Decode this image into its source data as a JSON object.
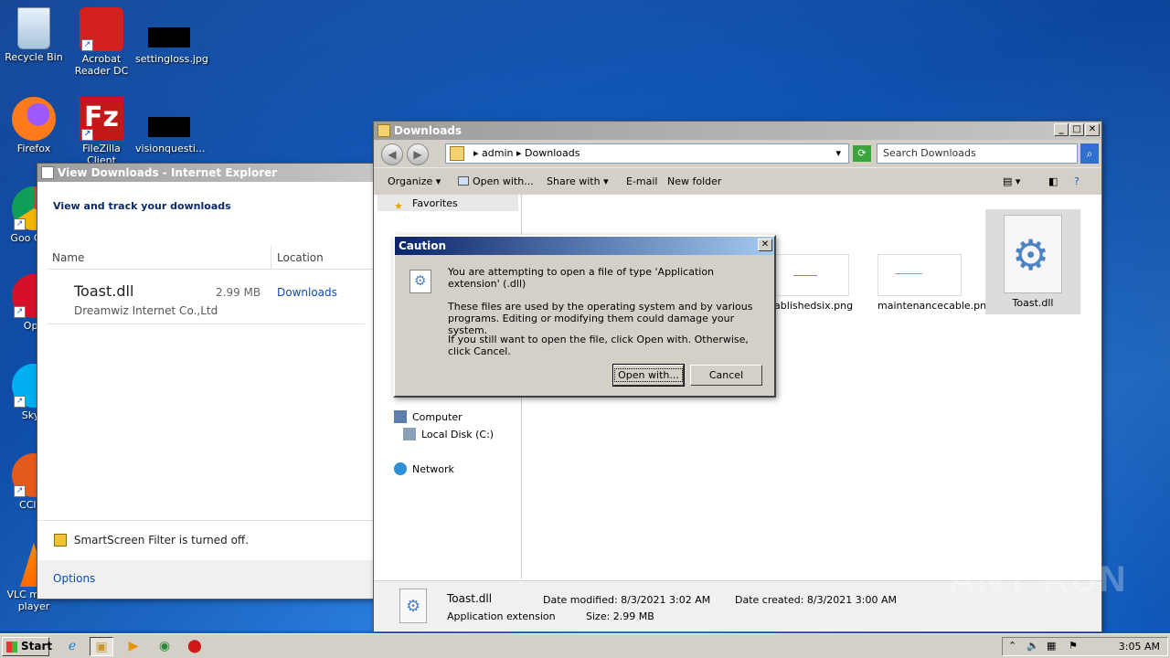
{
  "desktop": {
    "icons": [
      {
        "label": "Recycle Bin"
      },
      {
        "label": "Acrobat Reader DC"
      },
      {
        "label": "settingloss.jpg"
      },
      {
        "label": "Firefox"
      },
      {
        "label": "FileZilla Client"
      },
      {
        "label": "visionquesti..."
      },
      {
        "label": "Goo Chro"
      },
      {
        "label": "Ope"
      },
      {
        "label": "Skyp"
      },
      {
        "label": "CClea"
      },
      {
        "label": "VLC media player"
      }
    ]
  },
  "ie_window": {
    "title": "View Downloads - Internet Explorer",
    "heading": "View and track your downloads",
    "columns": {
      "name": "Name",
      "location": "Location"
    },
    "item": {
      "filename": "Toast.dll",
      "publisher": "Dreamwiz Internet Co.,Ltd",
      "size": "2.99 MB",
      "location": "Downloads"
    },
    "smartscreen": "SmartScreen Filter is turned off.",
    "options": "Options"
  },
  "explorer": {
    "title": "Downloads",
    "breadcrumb": [
      "admin",
      "Downloads"
    ],
    "search_placeholder": "Search Downloads",
    "commands": {
      "organize": "Organize",
      "open_with": "Open with...",
      "share_with": "Share with",
      "email": "E-mail",
      "new_folder": "New folder"
    },
    "nav": {
      "favorites": "Favorites",
      "computer": "Computer",
      "local_disk": "Local Disk (C:)",
      "network": "Network"
    },
    "files": [
      {
        "name": "stablishedsix.png"
      },
      {
        "name": "maintenancecable.png"
      },
      {
        "name": "Toast.dll"
      }
    ],
    "details": {
      "name": "Toast.dll",
      "type": "Application extension",
      "date_modified": "Date modified: 8/3/2021 3:02 AM",
      "date_created": "Date created: 8/3/2021 3:00 AM",
      "size": "Size: 2.99 MB"
    }
  },
  "dialog": {
    "title": "Caution",
    "line1": "You are attempting to open a file of type 'Application extension' (.dll)",
    "line2": "These files are used by the operating system and by various programs. Editing or modifying them could damage your system.",
    "line3": "If you still want to open the file, click Open with. Otherwise, click Cancel.",
    "open_with": "Open with...",
    "cancel": "Cancel"
  },
  "taskbar": {
    "start": "Start",
    "clock": "3:05 AM"
  },
  "watermark": "ANY RUN"
}
